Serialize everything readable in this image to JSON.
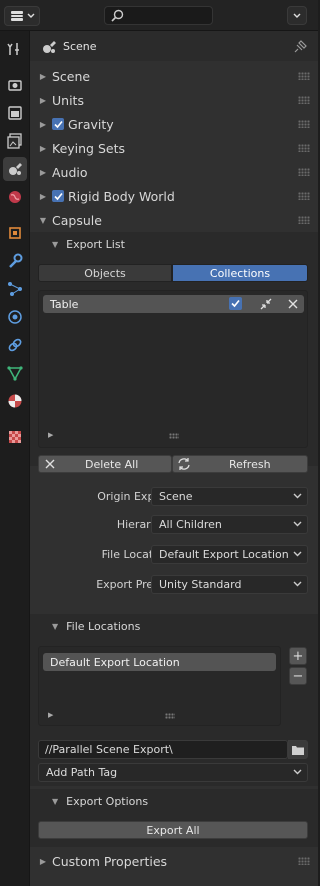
{
  "header": {
    "editor_icon": "properties-editor-icon",
    "search_placeholder": ""
  },
  "context": {
    "title": "Scene"
  },
  "sections": [
    {
      "label": "Scene",
      "checkbox": false
    },
    {
      "label": "Units",
      "checkbox": false
    },
    {
      "label": "Gravity",
      "checkbox": true
    },
    {
      "label": "Keying Sets",
      "checkbox": false
    },
    {
      "label": "Audio",
      "checkbox": false
    },
    {
      "label": "Rigid Body World",
      "checkbox": true
    },
    {
      "label": "Capsule",
      "checkbox": false,
      "expanded": true
    }
  ],
  "capsule": {
    "export_list": {
      "label": "Export List",
      "tabs": [
        "Objects",
        "Collections"
      ],
      "active_tab": "Collections",
      "items": [
        "Table"
      ],
      "delete_all": "Delete All",
      "refresh": "Refresh"
    },
    "props": [
      {
        "label": "Origin Export",
        "value": "Scene"
      },
      {
        "label": "Hierarchy",
        "value": "All Children"
      },
      {
        "label": "File Location",
        "value": "Default Export Location"
      },
      {
        "label": "Export Preset",
        "value": "Unity Standard"
      }
    ],
    "file_locations": {
      "label": "File Locations",
      "items": [
        "Default Export Location"
      ],
      "path": "//Parallel Scene Export\\",
      "add_path_tag": "Add Path Tag"
    },
    "export_options": {
      "label": "Export Options",
      "export_all": "Export All"
    }
  },
  "custom_properties": {
    "label": "Custom Properties"
  },
  "colors": {
    "accent": "#4772b3",
    "panel": "#303030",
    "background": "#1d1d1d"
  }
}
